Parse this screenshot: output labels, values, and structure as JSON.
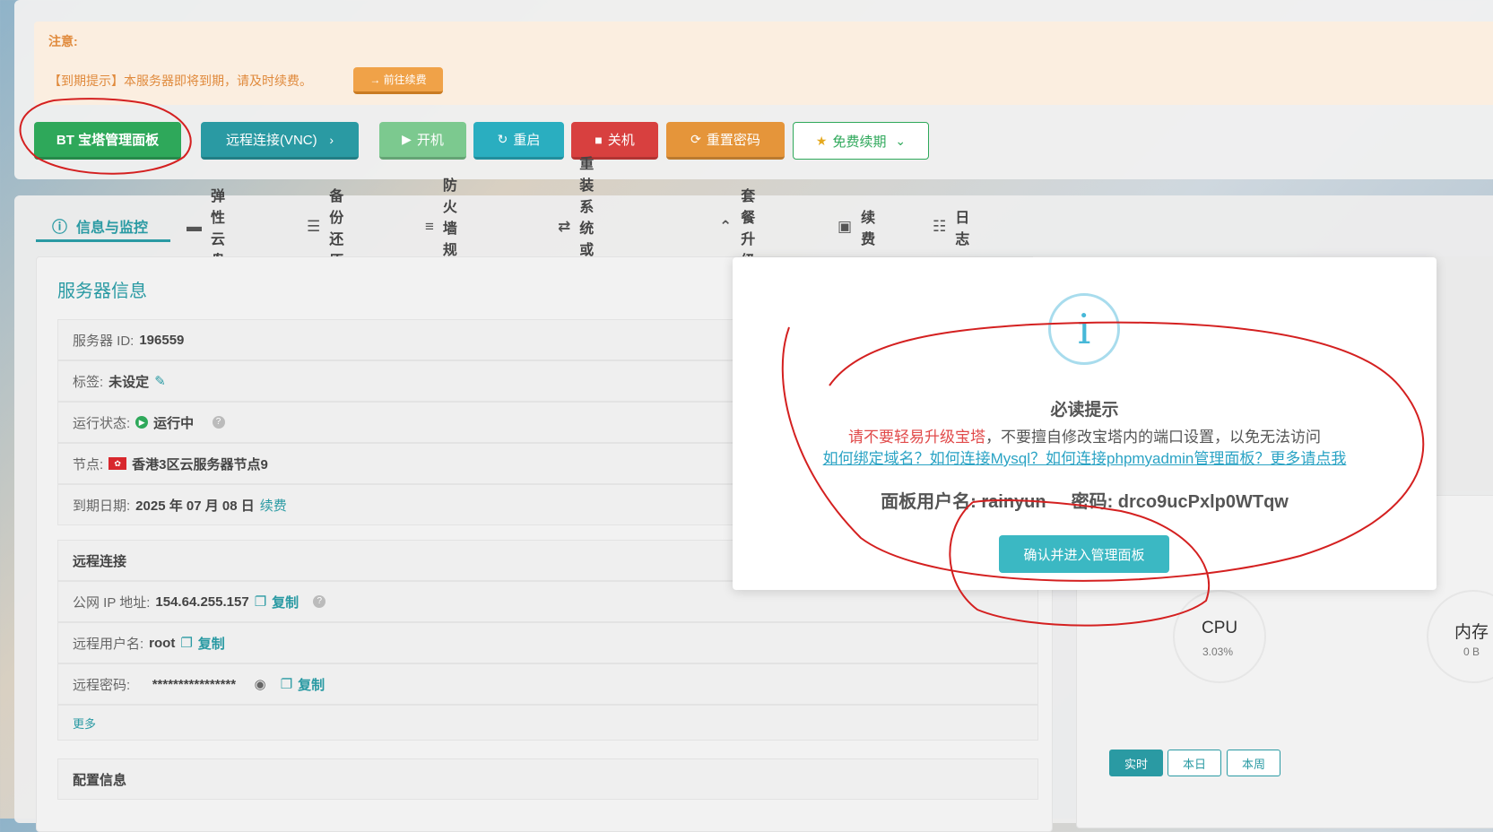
{
  "notice": {
    "title": "注意:",
    "text": "【到期提示】本服务器即将到期，请及时续费。",
    "renew_label": "→ 前往续费"
  },
  "actions": {
    "bt_label": "BT 宝塔管理面板",
    "vnc_label": "远程连接(VNC)",
    "start_label": "开机",
    "restart_label": "重启",
    "shutdown_label": "关机",
    "reset_pw_label": "重置密码",
    "free_renew_label": "免费续期"
  },
  "tabs": [
    {
      "label": "信息与监控",
      "icon": "info-icon"
    },
    {
      "label": "弹性云盘",
      "icon": "disk-icon"
    },
    {
      "label": "备份还原",
      "icon": "backup-icon"
    },
    {
      "label": "防火墙规则",
      "icon": "list-icon"
    },
    {
      "label": "重装系统或软件",
      "icon": "swap-icon"
    },
    {
      "label": "套餐升级",
      "icon": "upgrade-icon"
    },
    {
      "label": "续费",
      "icon": "money-icon"
    },
    {
      "label": "日志",
      "icon": "log-icon"
    }
  ],
  "server": {
    "title": "服务器信息",
    "id_label": "服务器 ID:",
    "id_value": "196559",
    "tag_label": "标签:",
    "tag_value": "未设定",
    "status_label": "运行状态:",
    "status_value": "运行中",
    "node_label": "节点:",
    "node_value": "香港3区云服务器节点9",
    "expire_label": "到期日期:",
    "expire_value": "2025 年 07 月 08 日",
    "expire_link": "续费"
  },
  "remote": {
    "title": "远程连接",
    "ip_label": "公网 IP 地址:",
    "ip_value": "154.64.255.157",
    "user_label": "远程用户名:",
    "user_value": "root",
    "pw_label": "远程密码:",
    "pw_value": "****************",
    "copy_label": "复制",
    "more_label": "更多"
  },
  "config": {
    "title": "配置信息"
  },
  "monitor": {
    "cpu_name": "CPU",
    "cpu_value": "3.03%",
    "mem_name": "内存",
    "mem_value": "0 B",
    "range": [
      "实时",
      "本日",
      "本周"
    ]
  },
  "modal": {
    "title": "必读提示",
    "warn_red": "请不要轻易升级宝塔",
    "warn_rest": "，不要擅自修改宝塔内的端口设置，以免无法访问",
    "links": "如何绑定域名？如何连接Mysql？如何连接phpmyadmin管理面板？更多请点我",
    "user_label": "面板用户名: rainyun",
    "pw_label": "密码: drco9ucPxlp0WTqw",
    "confirm_label": "确认并进入管理面板"
  },
  "colors": {
    "accent": "#2a9aa3",
    "green": "#2ea85a",
    "red": "#d8403f",
    "orange": "#e5953a",
    "annotation": "#d42020"
  }
}
